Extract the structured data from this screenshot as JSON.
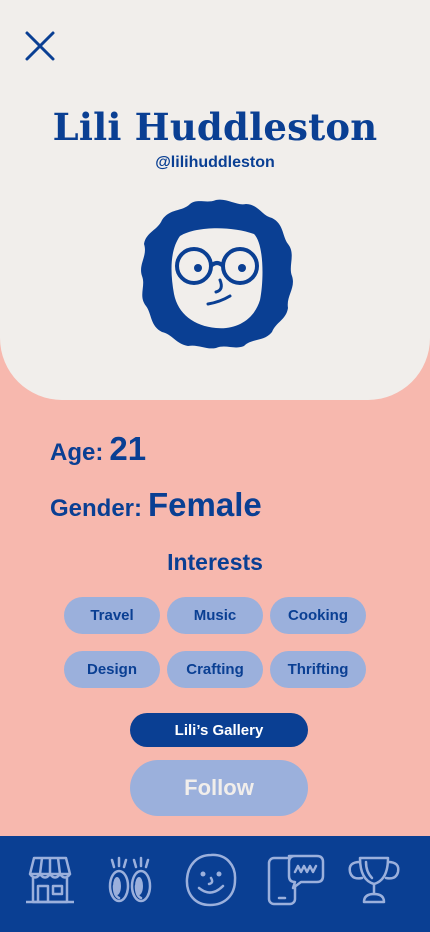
{
  "profile": {
    "name": "Lili Huddleston",
    "handle": "@lilihuddleston",
    "avatar_icon": "curly-hair-glasses-avatar"
  },
  "stats": {
    "age_label": "Age:",
    "age_value": "21",
    "gender_label": "Gender:",
    "gender_value": "Female"
  },
  "interests": {
    "title": "Interests",
    "items": [
      "Travel",
      "Music",
      "Cooking",
      "Design",
      "Crafting",
      "Thrifting"
    ]
  },
  "actions": {
    "gallery_label": "Lili’s Gallery",
    "follow_label": "Follow"
  },
  "tabbar": {
    "items": [
      "shop-icon",
      "eyes-icon",
      "smiley-icon",
      "chat-phone-icon",
      "trophy-icon"
    ]
  },
  "colors": {
    "primary": "#0a3f93",
    "background": "#f7b8ae",
    "card": "#f1eeeb",
    "chip": "#9bb0dc"
  }
}
